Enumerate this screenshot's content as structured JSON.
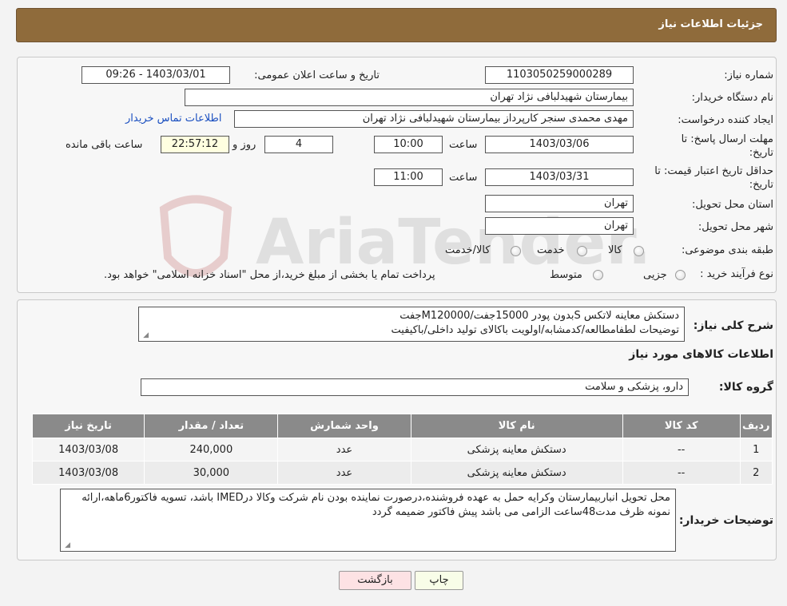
{
  "header": {
    "title": "جزئیات اطلاعات نیاز"
  },
  "watermark": {
    "text": "AriaTender.neT"
  },
  "form": {
    "need_number_label": "شماره نیاز:",
    "need_number": "1103050259000289",
    "announce_label": "تاریخ و ساعت اعلان عمومی:",
    "announce_value": "1403/03/01 - 09:26",
    "buyer_org_label": "نام دستگاه خریدار:",
    "buyer_org": "بیمارستان شهیدلبافی نژاد تهران",
    "creator_label": "ایجاد کننده درخواست:",
    "creator": "مهدی محمدی سنجر کارپرداز بیمارستان شهیدلبافی نژاد تهران",
    "contact_link": "اطلاعات تماس خریدار",
    "deadline_label_1": "مهلت ارسال پاسخ: تا",
    "deadline_label_2": "تاریخ:",
    "deadline_date": "1403/03/06",
    "time_label": "ساعت",
    "deadline_time": "10:00",
    "days_count": "4",
    "days_label": "روز و",
    "remaining_time": "22:57:12",
    "remaining_label": "ساعت باقی مانده",
    "validity_label_1": "حداقل تاریخ اعتبار قیمت: تا",
    "validity_label_2": "تاریخ:",
    "validity_date": "1403/03/31",
    "validity_time": "11:00",
    "province_label": "استان محل تحویل:",
    "province": "تهران",
    "city_label": "شهر محل تحویل:",
    "city": "تهران",
    "category_label": "طبقه بندی موضوعی:",
    "category_options": [
      "کالا",
      "خدمت",
      "کالا/خدمت"
    ],
    "process_label": "نوع فرآیند خرید :",
    "process_options": [
      "جزیی",
      "متوسط"
    ],
    "process_note": "پرداخت تمام یا بخشی از مبلغ خرید،از محل \"اسناد خزانه اسلامی\" خواهد بود."
  },
  "summary": {
    "label": "شرح کلی نیاز:",
    "line1": "دستکش معاینه لاتکس Sبدون پودر 15000جفت/M120000جفت",
    "line2": "توضیحات لطفامطالعه/کدمشابه/اولویت باکالای تولید داخلی/باکیفیت"
  },
  "goods": {
    "section_title": "اطلاعات کالاهای مورد نیاز",
    "group_label": "گروه کالا:",
    "group_value": "دارو، پزشکی و سلامت",
    "columns": [
      "ردیف",
      "کد کالا",
      "نام کالا",
      "واحد شمارش",
      "تعداد / مقدار",
      "تاریخ نیاز"
    ],
    "rows": [
      {
        "row": "1",
        "code": "--",
        "name": "دستکش معاینه پزشکی",
        "unit": "عدد",
        "qty": "240,000",
        "date": "1403/03/08"
      },
      {
        "row": "2",
        "code": "--",
        "name": "دستکش معاینه پزشکی",
        "unit": "عدد",
        "qty": "30,000",
        "date": "1403/03/08"
      }
    ]
  },
  "buyer_notes": {
    "label": "توضیحات خریدار:",
    "text": "محل تحویل انباربیمارستان وکرایه حمل به عهده فروشنده،درصورت نماینده بودن نام شرکت وکالا درIMED باشد، تسویه فاکتور6ماهه،ارائه نمونه ظرف مدت48ساعت الزامی می باشد پیش فاکتور ضمیمه گردد"
  },
  "buttons": {
    "print": "چاپ",
    "back": "بازگشت"
  }
}
